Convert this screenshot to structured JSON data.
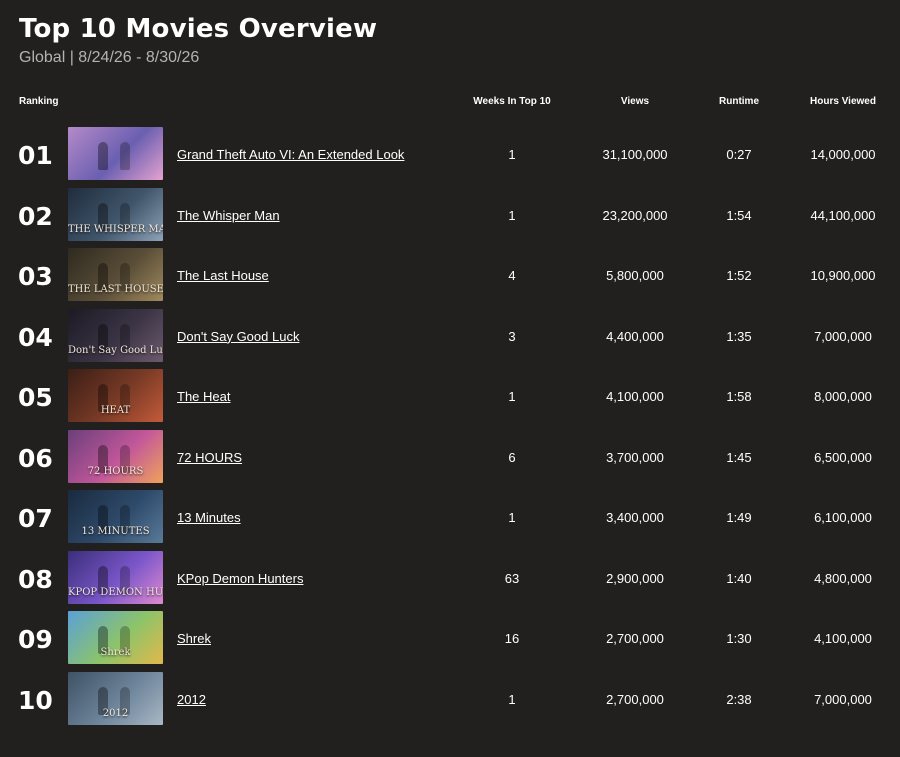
{
  "page": {
    "title": "Top 10 Movies Overview",
    "subtitle": "Global | 8/24/26 - 8/30/26"
  },
  "columns": {
    "ranking": "Ranking",
    "weeks": "Weeks In Top 10",
    "views": "Views",
    "runtime": "Runtime",
    "hours": "Hours Viewed"
  },
  "rows": [
    {
      "rank": "01",
      "title": "Grand Theft Auto VI: An Extended Look",
      "weeks": "1",
      "views": "31,100,000",
      "runtime": "0:27",
      "hours": "14,000,000",
      "thumb_caption": "",
      "thumb_colors": [
        "#b58ac9",
        "#6a5fb0",
        "#e6a3d0"
      ]
    },
    {
      "rank": "02",
      "title": "The Whisper Man",
      "weeks": "1",
      "views": "23,200,000",
      "runtime": "1:54",
      "hours": "44,100,000",
      "thumb_caption": "THE WHISPER MAN",
      "thumb_colors": [
        "#1f2d3d",
        "#41566b",
        "#8ea3b8"
      ]
    },
    {
      "rank": "03",
      "title": "The Last House",
      "weeks": "4",
      "views": "5,800,000",
      "runtime": "1:52",
      "hours": "10,900,000",
      "thumb_caption": "THE LAST HOUSE",
      "thumb_colors": [
        "#2e2a1f",
        "#5a4e38",
        "#a08a5e"
      ]
    },
    {
      "rank": "04",
      "title": "Don't Say Good Luck",
      "weeks": "3",
      "views": "4,400,000",
      "runtime": "1:35",
      "hours": "7,000,000",
      "thumb_caption": "Don't Say Good Luck",
      "thumb_colors": [
        "#1c1a24",
        "#3b3445",
        "#6d5a6e"
      ]
    },
    {
      "rank": "05",
      "title": "The Heat",
      "weeks": "1",
      "views": "4,100,000",
      "runtime": "1:58",
      "hours": "8,000,000",
      "thumb_caption": "HEAT",
      "thumb_colors": [
        "#3a1e16",
        "#7a3b26",
        "#c45a3a"
      ]
    },
    {
      "rank": "06",
      "title": "72 HOURS",
      "weeks": "6",
      "views": "3,700,000",
      "runtime": "1:45",
      "hours": "6,500,000",
      "thumb_caption": "72 HOURS",
      "thumb_colors": [
        "#6a3f7a",
        "#c2579a",
        "#f0a35a"
      ]
    },
    {
      "rank": "07",
      "title": "13 Minutes",
      "weeks": "1",
      "views": "3,400,000",
      "runtime": "1:49",
      "hours": "6,100,000",
      "thumb_caption": "13 MINUTES",
      "thumb_colors": [
        "#1a2a3f",
        "#2e4a6a",
        "#5a7a99"
      ]
    },
    {
      "rank": "08",
      "title": "KPop Demon Hunters",
      "weeks": "63",
      "views": "2,900,000",
      "runtime": "1:40",
      "hours": "4,800,000",
      "thumb_caption": "KPOP DEMON HUNTERS",
      "thumb_colors": [
        "#3a2f7a",
        "#7a56c9",
        "#e08ad0"
      ]
    },
    {
      "rank": "09",
      "title": "Shrek",
      "weeks": "16",
      "views": "2,700,000",
      "runtime": "1:30",
      "hours": "4,100,000",
      "thumb_caption": "Shrek",
      "thumb_colors": [
        "#5aa0d8",
        "#8cc46a",
        "#e2b84a"
      ]
    },
    {
      "rank": "10",
      "title": "2012",
      "weeks": "1",
      "views": "2,700,000",
      "runtime": "2:38",
      "hours": "7,000,000",
      "thumb_caption": "2012",
      "thumb_colors": [
        "#3f5266",
        "#6e859b",
        "#a8b7c4"
      ]
    }
  ]
}
